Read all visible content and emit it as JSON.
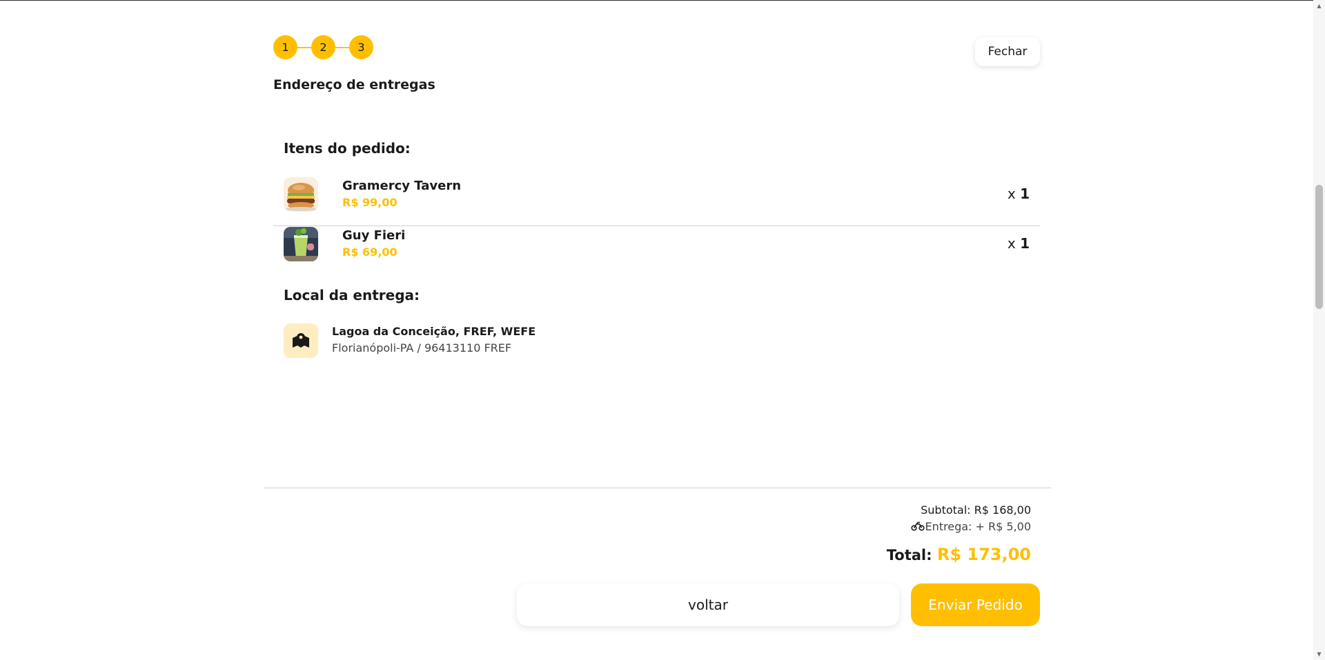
{
  "stepper": {
    "steps": [
      "1",
      "2",
      "3"
    ]
  },
  "header": {
    "close_label": "Fechar",
    "step_title": "Endereço de entregas"
  },
  "order": {
    "title": "Itens do pedido:",
    "items": [
      {
        "name": "Gramercy Tavern",
        "price": "R$ 99,00",
        "qty_prefix": "x",
        "qty": "1",
        "image": "burger-photo"
      },
      {
        "name": "Guy Fieri",
        "price": "R$ 69,00",
        "qty_prefix": "x",
        "qty": "1",
        "image": "drink-photo"
      }
    ]
  },
  "delivery_location": {
    "title": "Local da entrega:",
    "icon": "map-icon",
    "line1": "Lagoa da Conceição, FREF, WEFE",
    "line2": "Florianópoli-PA / 96413110 FREF"
  },
  "summary": {
    "subtotal": "Subtotal: R$ 168,00",
    "delivery_icon": "motorcycle-icon",
    "delivery": "Entrega: + R$ 5,00",
    "total_label": "Total:",
    "total_value": "R$ 173,00"
  },
  "actions": {
    "back_label": "voltar",
    "send_label": "Enviar Pedido"
  },
  "colors": {
    "accent": "#ffbf00",
    "accent_light": "#ffedc2",
    "divider": "#cfcfcf"
  }
}
